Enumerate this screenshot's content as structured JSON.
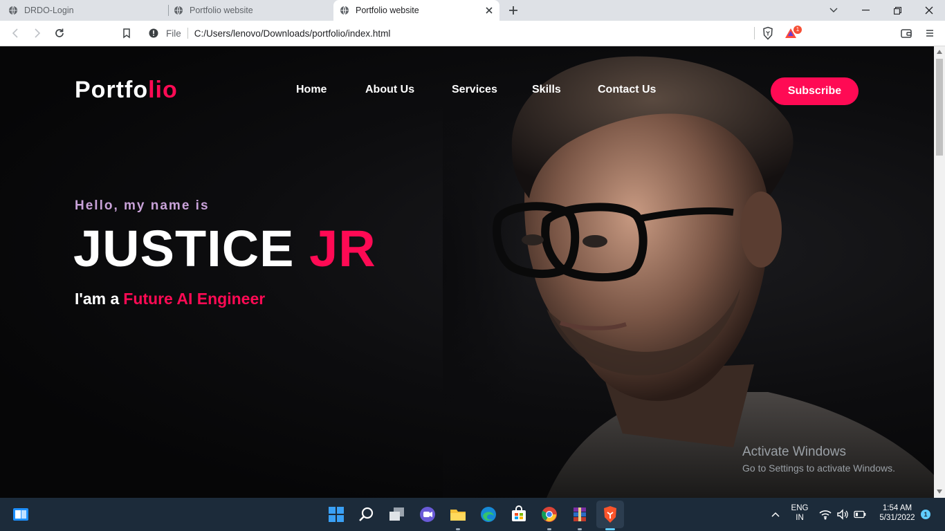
{
  "browser": {
    "tabs": [
      {
        "title": "DRDO-Login"
      },
      {
        "title": "Portfolio website"
      },
      {
        "title": "Portfolio website"
      }
    ],
    "scheme": "File",
    "url": "C:/Users/lenovo/Downloads/portfolio/index.html",
    "notification_count": "1"
  },
  "page": {
    "logo": {
      "main": "Portfo",
      "accent": "lio"
    },
    "nav": [
      "Home",
      "About Us",
      "Services",
      "Skills",
      "Contact Us"
    ],
    "subscribe_label": "Subscribe",
    "greeting": "Hello, my name is",
    "name": {
      "main": "JUSTICE",
      "accent": "JR"
    },
    "role": {
      "prefix": "I'am a",
      "accent": "Future AI Engineer"
    },
    "colors": {
      "accent": "#ff0a54",
      "greeting": "#c9a2d9",
      "background": "#0b0b0d"
    }
  },
  "watermark": {
    "title": "Activate Windows",
    "subtitle": "Go to Settings to activate Windows."
  },
  "taskbar": {
    "lang_top": "ENG",
    "lang_bottom": "IN",
    "time": "1:54 AM",
    "date": "5/31/2022",
    "notif_count": "1"
  }
}
